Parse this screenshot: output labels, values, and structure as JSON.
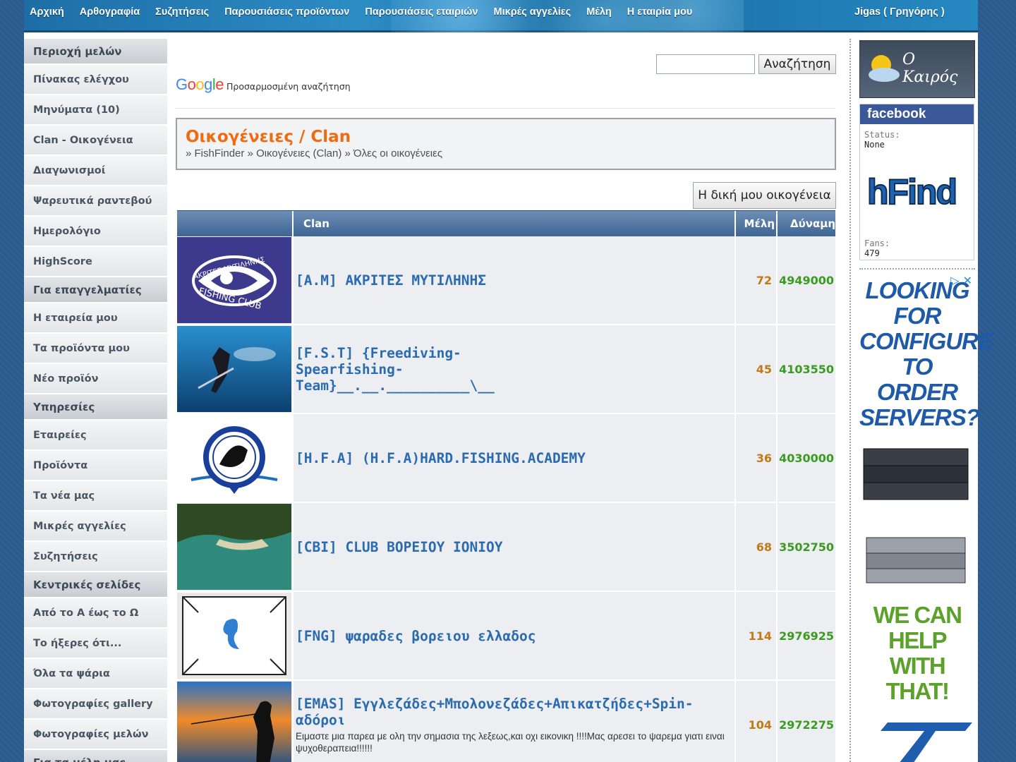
{
  "nav": {
    "items": [
      "Αρχική",
      "Αρθογραφία",
      "Συζητήσεις",
      "Παρουσιάσεις προϊόντων",
      "Παρουσιάσεις εταιριών",
      "Μικρές αγγελίες",
      "Μέλη",
      "Η εταιρία μου"
    ],
    "user": "Jigas ( Γρηγόρης )"
  },
  "sidebar": {
    "sections": [
      {
        "title": "Περιοχή μελών",
        "items": [
          "Πίνακας ελέγχου",
          "Μηνύματα (10)",
          "Clan - Οικογένεια",
          "Διαγωνισμοί",
          "Ψαρευτικά ραντεβού",
          "Ημερολόγιο",
          "HighScore"
        ]
      },
      {
        "title": "Για επαγγελματίες",
        "items": [
          "Η εταιρεία μου",
          "Τα προϊόντα μου",
          "Νέο προϊόν"
        ]
      },
      {
        "title": "Υπηρεσίες",
        "items": [
          "Εταιρείες",
          "Προϊόντα",
          "Τα νέα μας",
          "Μικρές αγγελίες",
          "Συζητήσεις"
        ]
      },
      {
        "title": "Κεντρικές σελίδες",
        "items": [
          "Από το Α έως το Ω",
          "Το ήξερες ότι...",
          "Όλα τα ψάρια",
          "Φωτογραφίες gallery",
          "Φωτογραφίες μελών"
        ]
      },
      {
        "title": "Για τα μέλη μας",
        "items": []
      }
    ]
  },
  "search": {
    "value": "",
    "button": "Αναζήτηση",
    "google_text": "Προσαρμοσμένη αναζήτηση"
  },
  "page": {
    "title": "Οικογένειες / Clan",
    "breadcrumb": [
      "FishFinder",
      "Οικογένειες (Clan)",
      "Όλες οι οικογένειες"
    ],
    "my_clan_button": "Η δική μου οικογένεια"
  },
  "table": {
    "headers": {
      "clan": "Clan",
      "members": "Μέλη",
      "power": "Δύναμη"
    },
    "rows": [
      {
        "name": "[A.M] ΑΚΡΙΤΕΣ ΜΥΤΙΛΗΝΗΣ",
        "desc": "",
        "members": "72",
        "power": "4949000"
      },
      {
        "name": "[F.S.T] {Freediving-Spearfishing-Team}__.__.__________\\__",
        "desc": "",
        "members": "45",
        "power": "4103550"
      },
      {
        "name": "[H.F.A] (H.F.A)HARD.FISHING.ACADEMY",
        "desc": "",
        "members": "36",
        "power": "4030000"
      },
      {
        "name": "[CBI] CLUB ΒΟΡΕΙΟΥ ΙΟΝΙΟΥ",
        "desc": "",
        "members": "68",
        "power": "3502750"
      },
      {
        "name": "[FNG] ψαραδες βορειου ελλαδος",
        "desc": "",
        "members": "114",
        "power": "2976925"
      },
      {
        "name": "[EMAS] Εγγλεζάδες+Μπολονεζάδες+Απικατζήδες+Spin-αδόροι",
        "desc": "Ειμαστε μια παρεα με ολη την σημασια της λεξεως,και οχι εικονικη !!!!Μας αρεσει το ψαρεμα γιατι ειναι ψυχοθεραπεια!!!!!!",
        "members": "104",
        "power": "2972275"
      }
    ]
  },
  "right": {
    "weather_label": "Ο Καιρός",
    "fb_title": "facebook",
    "fb_status_label": "Status:",
    "fb_status": "None",
    "fb_logo": "hFind",
    "fb_fans_label": "Fans:",
    "fb_fans": "479",
    "ad_lines": [
      "LOOKING",
      "FOR",
      "CONFIGURE",
      "TO ORDER",
      "SERVERS?"
    ],
    "ad_green": [
      "WE CAN",
      "HELP WITH",
      "THAT!"
    ]
  }
}
